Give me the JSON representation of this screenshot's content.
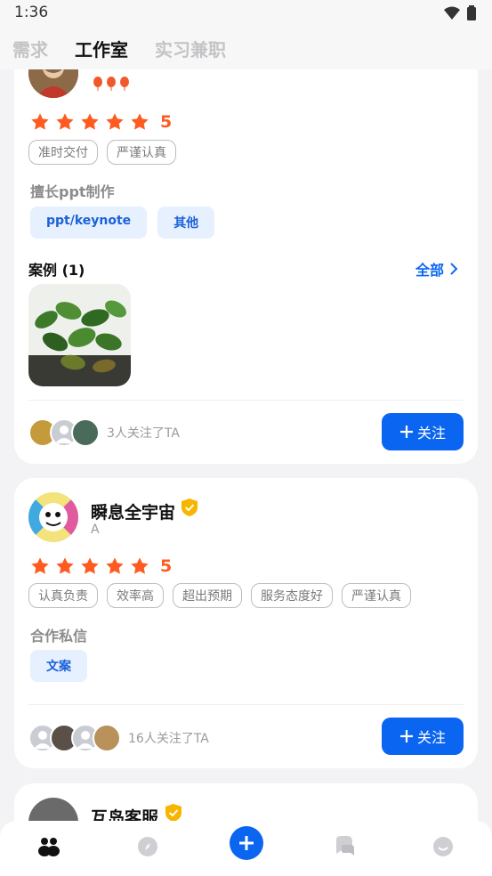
{
  "status": {
    "time": "1:36"
  },
  "tabs": [
    "需求",
    "工作室",
    "实习兼职"
  ],
  "card1": {
    "score": "5",
    "tags": [
      "准时交付",
      "严谨认真"
    ],
    "skill_title": "擅长ppt制作",
    "skills": [
      "ppt/keynote",
      "其他"
    ],
    "cases_title": "案例 (1)",
    "all_label": "全部",
    "followers_text": "3人关注了TA",
    "follow_label": "关注"
  },
  "card2": {
    "name": "瞬息全宇宙",
    "subtitle": "A",
    "score": "5",
    "tags": [
      "认真负责",
      "效率高",
      "超出预期",
      "服务态度好",
      "严谨认真"
    ],
    "skill_title": "合作私信",
    "skills": [
      "文案"
    ],
    "followers_text": "16人关注了TA",
    "follow_label": "关注"
  },
  "card3": {
    "name": "互岛客服"
  },
  "colors": {
    "accent": "#0a66f0",
    "star": "#ff5a1f",
    "verified": "#f7b500"
  }
}
